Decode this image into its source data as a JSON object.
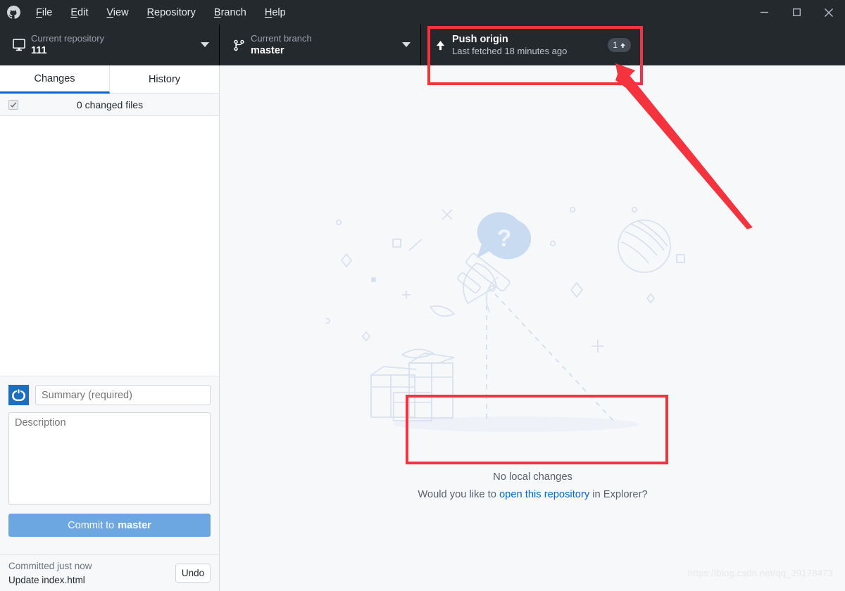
{
  "window": {
    "logo_icon": "github-octocat-icon",
    "controls": [
      {
        "name": "minimize-button",
        "icon": "minimize-icon"
      },
      {
        "name": "maximize-button",
        "icon": "maximize-icon"
      },
      {
        "name": "close-button",
        "icon": "close-icon"
      }
    ]
  },
  "menubar": {
    "items": [
      {
        "label": "File",
        "mnemonic": "F"
      },
      {
        "label": "Edit",
        "mnemonic": "E"
      },
      {
        "label": "View",
        "mnemonic": "V"
      },
      {
        "label": "Repository",
        "mnemonic": "R"
      },
      {
        "label": "Branch",
        "mnemonic": "B"
      },
      {
        "label": "Help",
        "mnemonic": "H"
      }
    ]
  },
  "toolbar": {
    "repository": {
      "icon": "desktop-monitor-icon",
      "label": "Current repository",
      "value": "111",
      "caret_icon": "chevron-down-icon"
    },
    "branch": {
      "icon": "git-branch-icon",
      "label": "Current branch",
      "value": "master",
      "caret_icon": "chevron-down-icon"
    },
    "push": {
      "icon": "arrow-up-icon",
      "title": "Push origin",
      "subtitle": "Last fetched 18 minutes ago",
      "badge_count": "1",
      "badge_icon": "arrow-up-small-icon"
    }
  },
  "sidebar": {
    "tabs": [
      {
        "label": "Changes",
        "active": true
      },
      {
        "label": "History",
        "active": false
      }
    ],
    "changes_header": {
      "checkbox_state": "checked",
      "count_label": "0 changed files"
    },
    "commit_form": {
      "avatar_icon": "github-desktop-avatar-icon",
      "summary_placeholder": "Summary (required)",
      "summary_value": "",
      "description_placeholder": "Description",
      "description_value": "",
      "commit_button_prefix": "Commit to ",
      "commit_button_branch": "master"
    },
    "undo_bar": {
      "status": "Committed just now",
      "commit_message": "Update index.html",
      "undo_label": "Undo"
    }
  },
  "main": {
    "illustration": "telescope-question-blankslate-illustration",
    "no_changes_title": "No local changes",
    "no_changes_prefix": "Would you like to ",
    "no_changes_link": "open this repository",
    "no_changes_suffix": " in Explorer?"
  },
  "watermark": {
    "text": "https://blog.csdn.net/qq_39178473"
  },
  "annotations": {
    "highlight_push_label": "push-origin-highlight",
    "highlight_message_label": "no-local-changes-highlight",
    "arrow_label": "pointer-arrow-to-push-origin",
    "color": "#f5333f"
  },
  "colors": {
    "titlebar_bg": "#24292e",
    "accent_blue": "#0366d6",
    "commit_button": "#6ca7e2",
    "panel_bg": "#f6f8fa",
    "annotation_red": "#f5333f"
  }
}
